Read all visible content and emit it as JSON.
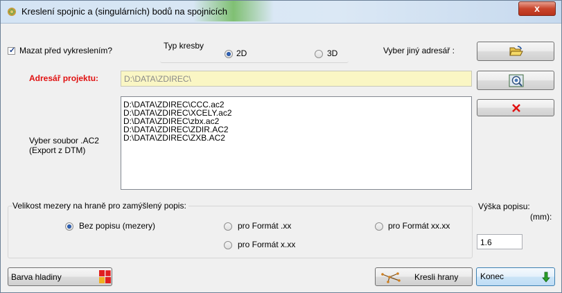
{
  "window": {
    "title": "Kreslení spojnic a (singulárních) bodů na spojnicích",
    "close_symbol": "x"
  },
  "delete_before": {
    "label": "Mazat před vykreslením?",
    "checked": true
  },
  "draw_type": {
    "label": "Typ kresby",
    "options": [
      "2D",
      "3D"
    ],
    "selected": "2D"
  },
  "choose_dir": {
    "label": "Vyber jiný adresář :"
  },
  "project_dir": {
    "label": "Adresář projektu:",
    "value": "D:\\DATA\\ZDIREC\\"
  },
  "file_select": {
    "label_line1": "Vyber soubor .AC2",
    "label_line2": "(Export z DTM)",
    "files": [
      "D:\\DATA\\ZDIREC\\CCC.ac2",
      "D:\\DATA\\ZDIREC\\XCELY.ac2",
      "D:\\DATA\\ZDIREC\\zbx.ac2",
      "D:\\DATA\\ZDIREC\\ZDIR.AC2",
      "D:\\DATA\\ZDIREC\\ZXB.AC2"
    ]
  },
  "gap_size": {
    "label": "Velikost mezery na hraně  pro zamýšlený popis:",
    "options": [
      "Bez popisu (mezery)",
      "pro Formát .xx",
      "pro Formát xx.xx",
      "pro Formát x.xx"
    ],
    "selected": "Bez popisu (mezery)"
  },
  "label_height": {
    "label_line1": "Výška popisu:",
    "label_line2": "(mm):",
    "value": "1.6"
  },
  "buttons": {
    "layer_color": "Barva hladiny",
    "draw_edges": "Kresli hrany",
    "end": "Konec"
  },
  "colors": {
    "accent_red": "#e01010",
    "project_dir_bg": "#faf6c4",
    "titlebar": "#d4e4f4",
    "close": "#c9452c"
  }
}
